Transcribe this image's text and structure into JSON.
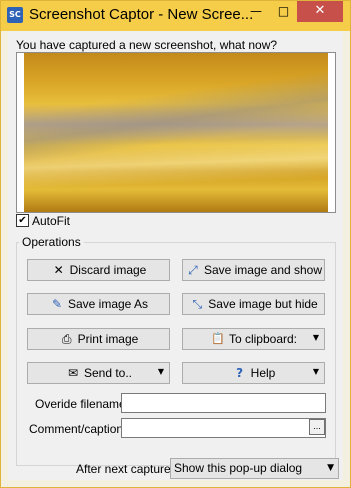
{
  "window": {
    "title": "Screenshot Captor - New Screenshot",
    "title_visible": "Screenshot Captor - New Scree...",
    "app_icon_text": "SC",
    "minimize_glyph": "—",
    "maximize_glyph": "□",
    "close_glyph": "✕"
  },
  "prompt": "You have captured a new screenshot, what now?",
  "autofit": {
    "label": "AutoFit",
    "checked": true,
    "check_glyph": "✔"
  },
  "operations": {
    "legend": "Operations",
    "buttons": {
      "discard": {
        "label": "Discard image",
        "icon": "x-icon",
        "glyph": "✕"
      },
      "save_show": {
        "label": "Save image and show",
        "icon": "save-show-icon",
        "glyph": "⤢"
      },
      "save_as": {
        "label": "Save image As",
        "icon": "save-as-icon",
        "glyph": "✎"
      },
      "save_hide": {
        "label": "Save image but hide",
        "icon": "save-hide-icon",
        "glyph": "⤡"
      },
      "print": {
        "label": "Print image",
        "icon": "printer-icon",
        "glyph": "⎙"
      },
      "clipboard": {
        "label": "To clipboard:",
        "icon": "clipboard-icon",
        "glyph": "📋"
      },
      "send_to": {
        "label": "Send to..",
        "icon": "send-to-icon",
        "glyph": "✉"
      },
      "help": {
        "label": "Help",
        "icon": "help-icon",
        "glyph": "?"
      }
    },
    "caret": "▼"
  },
  "override_filename": {
    "label": "Overide filename:",
    "value": ""
  },
  "comment": {
    "label": "Comment/caption:",
    "value": "",
    "ellipsis": "..."
  },
  "after_capture": {
    "label": "After next capture:",
    "selected": "Show this pop-up dialog"
  },
  "colors": {
    "titlebar": "#f5cd49",
    "close_button": "#c7504a",
    "window_border": "#e0b33a"
  }
}
